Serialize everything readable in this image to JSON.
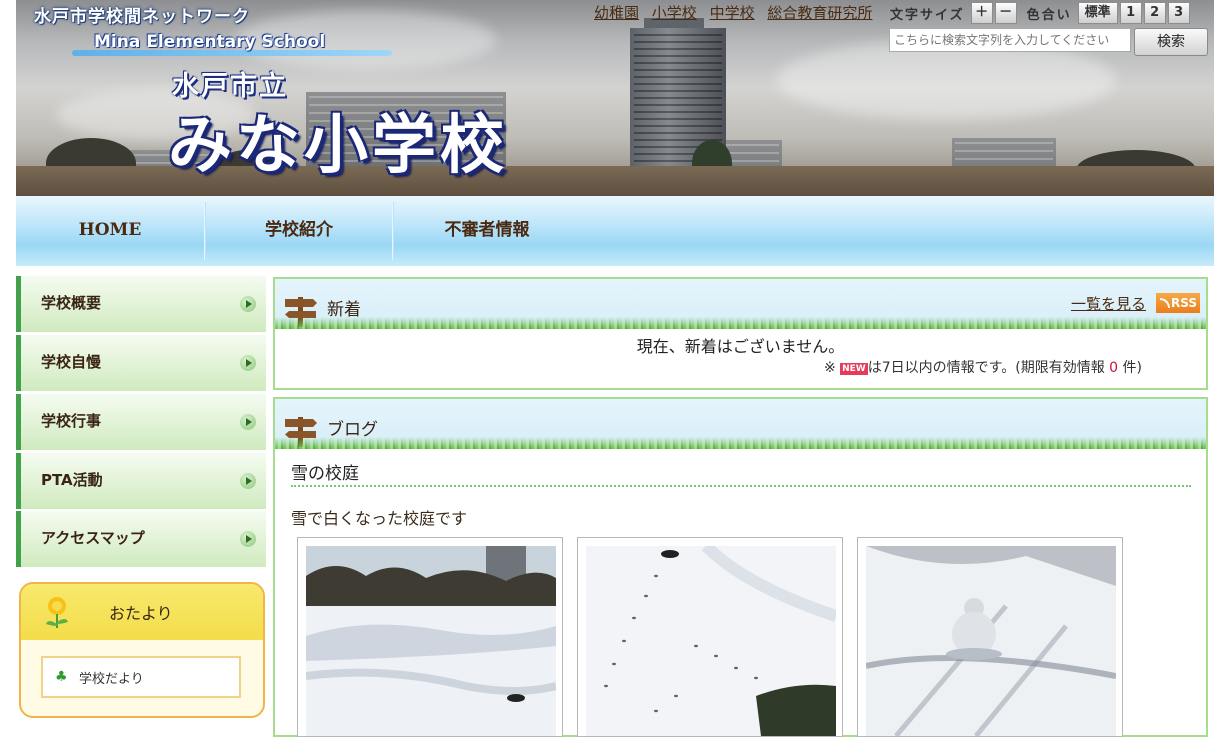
{
  "header": {
    "network_title": "水戸市学校間ネットワーク",
    "english_name": "Mina Elementary School",
    "city_label": "水戸市立",
    "school_name": "みな小学校",
    "top_links": [
      "幼稚園",
      "小学校",
      "中学校",
      "総合教育研究所"
    ],
    "font_size_label": "文字サイズ",
    "font_size_plus": "＋",
    "font_size_minus": "－",
    "color_label": "色合い",
    "color_options": [
      "標準",
      "1",
      "2",
      "3"
    ],
    "search_placeholder": "こちらに検索文字列を入力してください",
    "search_button": "検索"
  },
  "nav": {
    "items": [
      "HOME",
      "学校紹介",
      "不審者情報"
    ]
  },
  "sidebar": {
    "items": [
      "学校概要",
      "学校自慢",
      "学校行事",
      "PTA活動",
      "アクセスマップ"
    ],
    "otayori": {
      "title": "おたより",
      "link": "学校だより"
    }
  },
  "news": {
    "title": "新着",
    "more_link": "一覧を見る",
    "rss_label": "RSS",
    "empty_message": "現在、新着はございません。",
    "note_prefix": "※",
    "new_badge": "NEW",
    "note_text": "は7日以内の情報です。(期限有効情報",
    "count": "0",
    "note_suffix": "件)"
  },
  "blog": {
    "title": "ブログ",
    "post_title": "雪の校庭",
    "post_text": "雪で白くなった校庭です",
    "photos": [
      "snowy-schoolyard-photo",
      "footprints-in-snow-photo",
      "snowman-photo"
    ]
  },
  "colors": {
    "sidebar_accent": "#43a14c",
    "panel_border": "#a5dc8f",
    "nav_sky": "#9ad7f5",
    "link_brown": "#4a2b12",
    "count_red": "#c4123a"
  }
}
